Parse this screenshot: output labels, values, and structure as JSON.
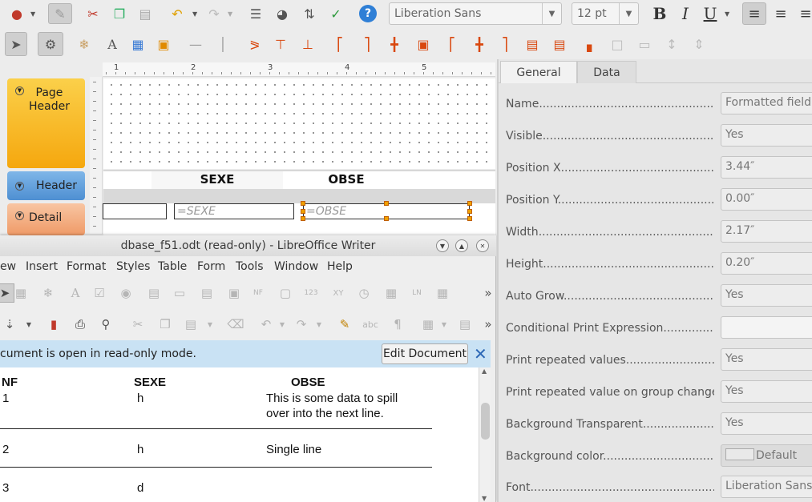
{
  "toolbar": {
    "font_name": "Liberation Sans",
    "font_size": "12 pt",
    "bold_label": "B",
    "italic_label": "I",
    "underline_label": "U",
    "help_label": "?"
  },
  "ruler": {
    "numbers": [
      "1",
      "2",
      "3",
      "4",
      "5"
    ]
  },
  "sections": {
    "page_header": [
      "Page",
      "Header"
    ],
    "header": "Header",
    "detail": "Detail"
  },
  "report": {
    "header_fields": [
      "SEXE",
      "OBSE"
    ],
    "detail_fields": [
      "=SEXE",
      "=OBSE"
    ]
  },
  "writer": {
    "title": "dbase_f51.odt (read-only) - LibreOffice Writer",
    "menu": [
      "ew",
      "Insert",
      "Format",
      "Styles",
      "Table",
      "Form",
      "Tools",
      "Window",
      "Help"
    ],
    "notice": "cument is open in read-only mode.",
    "edit_button": "Edit Document",
    "close_notice": "✕",
    "columns": [
      "NF",
      "SEXE",
      "OBSE"
    ],
    "rows": [
      {
        "nf": "1",
        "sexe": "h",
        "obse_lines": [
          "This is some data to spill",
          "over into the next line."
        ]
      },
      {
        "nf": "2",
        "sexe": "h",
        "obse_lines": [
          "Single line"
        ]
      },
      {
        "nf": "3",
        "sexe": "d",
        "obse_lines": []
      }
    ]
  },
  "properties": {
    "tabs": [
      "General",
      "Data"
    ],
    "selected_tab": "General",
    "rows": [
      {
        "label": "Name",
        "value": "Formatted field"
      },
      {
        "label": "Visible",
        "value": "Yes"
      },
      {
        "label": "Position X",
        "value": "3.44″"
      },
      {
        "label": "Position Y",
        "value": "0.00″"
      },
      {
        "label": "Width",
        "value": "2.17″"
      },
      {
        "label": "Height",
        "value": "0.20″"
      },
      {
        "label": "Auto Grow",
        "value": "Yes"
      },
      {
        "label": "Conditional Print Expression",
        "value": ""
      },
      {
        "label": "Print repeated values",
        "value": "Yes"
      },
      {
        "label": "Print repeated value on group change",
        "value": "Yes"
      },
      {
        "label": "Background Transparent",
        "value": "Yes"
      },
      {
        "label": "Background color",
        "value": "Default"
      },
      {
        "label": "Font",
        "value": "Liberation Sans,"
      }
    ]
  }
}
